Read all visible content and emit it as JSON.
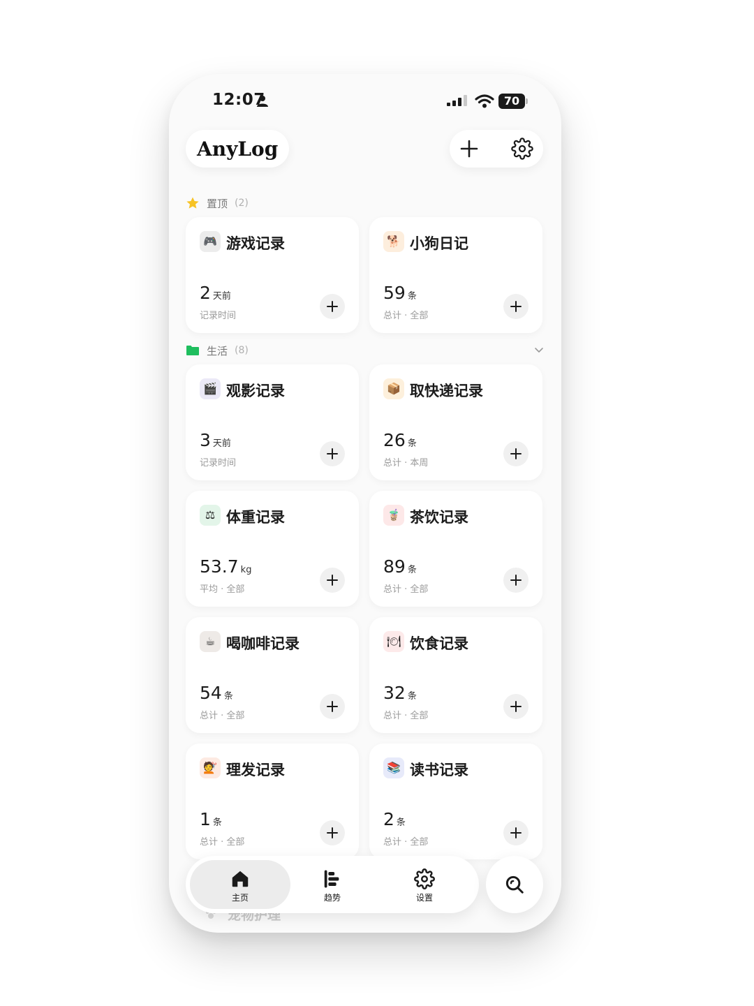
{
  "status": {
    "time": "12:07",
    "battery": "70"
  },
  "app": {
    "title": "AnyLog"
  },
  "sections": [
    {
      "title": "置顶",
      "count": "(2)"
    },
    {
      "title": "生活",
      "count": "(8)"
    }
  ],
  "cards": [
    {
      "emoji": "🎮",
      "icon_bg": "#ececec",
      "title": "游戏记录",
      "value": "2",
      "unit": "天前",
      "caption": "记录时间"
    },
    {
      "emoji": "🐕",
      "icon_bg": "#fdeedd",
      "title": "小狗日记",
      "value": "59",
      "unit": "条",
      "caption": "总计 · 全部"
    },
    {
      "emoji": "🎬",
      "icon_bg": "#ebe9f7",
      "title": "观影记录",
      "value": "3",
      "unit": "天前",
      "caption": "记录时间"
    },
    {
      "emoji": "📦",
      "icon_bg": "#fdf0dc",
      "title": "取快递记录",
      "value": "26",
      "unit": "条",
      "caption": "总计 · 本周"
    },
    {
      "emoji": "⚖",
      "icon_bg": "#e3f5e9",
      "title": "体重记录",
      "value": "53.7",
      "unit": "kg",
      "caption": "平均 · 全部"
    },
    {
      "emoji": "🧋",
      "icon_bg": "#fde8e8",
      "title": "茶饮记录",
      "value": "89",
      "unit": "条",
      "caption": "总计 · 全部"
    },
    {
      "emoji": "☕",
      "icon_bg": "#eeeae7",
      "title": "喝咖啡记录",
      "value": "54",
      "unit": "条",
      "caption": "总计 · 全部"
    },
    {
      "emoji": "🍽",
      "icon_bg": "#fdeaea",
      "title": "饮食记录",
      "value": "32",
      "unit": "条",
      "caption": "总计 · 全部"
    },
    {
      "emoji": "💇",
      "icon_bg": "#fdeae2",
      "title": "理发记录",
      "value": "1",
      "unit": "条",
      "caption": "总计 · 全部"
    },
    {
      "emoji": "📚",
      "icon_bg": "#e7eafa",
      "title": "读书记录",
      "value": "2",
      "unit": "条",
      "caption": "总计 · 全部"
    }
  ],
  "ghost_item": {
    "title": "宠物护理"
  },
  "tabs": [
    {
      "label": "主页",
      "icon": "home-icon"
    },
    {
      "label": "趋势",
      "icon": "chart-icon"
    },
    {
      "label": "设置",
      "icon": "gear-icon"
    }
  ],
  "colors": {
    "star": "#f7c325",
    "folder": "#1fbe5e"
  }
}
